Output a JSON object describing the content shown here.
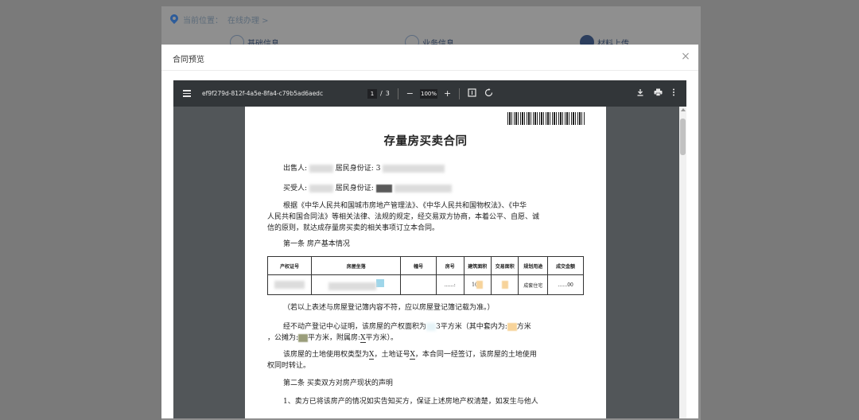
{
  "background": {
    "location_label": "当前位置：",
    "location_value": "在线办理 >",
    "steps": [
      {
        "label": "基础信息"
      },
      {
        "label": "业务信息"
      },
      {
        "label": "材料上传"
      }
    ]
  },
  "dialog": {
    "title": "合同预览",
    "close_glyph": "×"
  },
  "viewer": {
    "filename": "ef9f279d-812f-4a5e-8fa4-c79b5ad6aedc",
    "current_page": "1",
    "page_sep": "/",
    "total_pages": "3",
    "zoom_minus": "−",
    "zoom": "100%",
    "zoom_plus": "+",
    "scrollbar_position": 0.02
  },
  "document": {
    "title": "存量房买卖合同",
    "seller_label": "出售人:",
    "seller_id_label": "居民身份证:",
    "seller_id_partial": "3",
    "buyer_label": "买受人:",
    "buyer_id_label": "居民身份证:",
    "para1_line1": "根据《中华人民共和国城市房地产管理法》、《中华人民共和国物权法》、《中华",
    "para1_line2": "人民共和国合同法》等相关法律、法规的规定，经交易双方协商，本着公平、自愿、诚",
    "para1_line3": "信的原则，就达成存量房买卖的相关事项订立本合同。",
    "article1": "第一条  房产基本情况",
    "table_headers": [
      "产权证号",
      "房屋坐落",
      "幢号",
      "房号",
      "建筑面积",
      "交易面积",
      "规划用途",
      "成交金额"
    ],
    "table_row": {
      "room_partial": "……:",
      "area_partial": "1(",
      "usage": "成套住宅",
      "amount_partial": "……00"
    },
    "note": "（若以上表述与房屋登记簿内容不符，应以房屋登记簿记载为准。）",
    "para2_a": "经不动产登记中心证明，该房屋的产权面积为",
    "para2_b": "3平方米（其中套内为:",
    "para2_c": "方米",
    "para2_d": "，公摊为:",
    "para2_e": "平方米，附属房:",
    "para2_x": "X",
    "para2_f": "平方米）。",
    "para3_a": "该房屋的土地使用权类型为",
    "para3_x1": "X",
    "para3_b": "，土地证号",
    "para3_x2": "X",
    "para3_c": "，本合同一经签订，该房屋的土地使用",
    "para3_line2": "权同时转让。",
    "article2": "第二条  买卖双方对房产现状的声明",
    "para4": "1、卖方已将该房产的情况如实告知买方，保证上述房地产权清楚，如发生与他人"
  }
}
